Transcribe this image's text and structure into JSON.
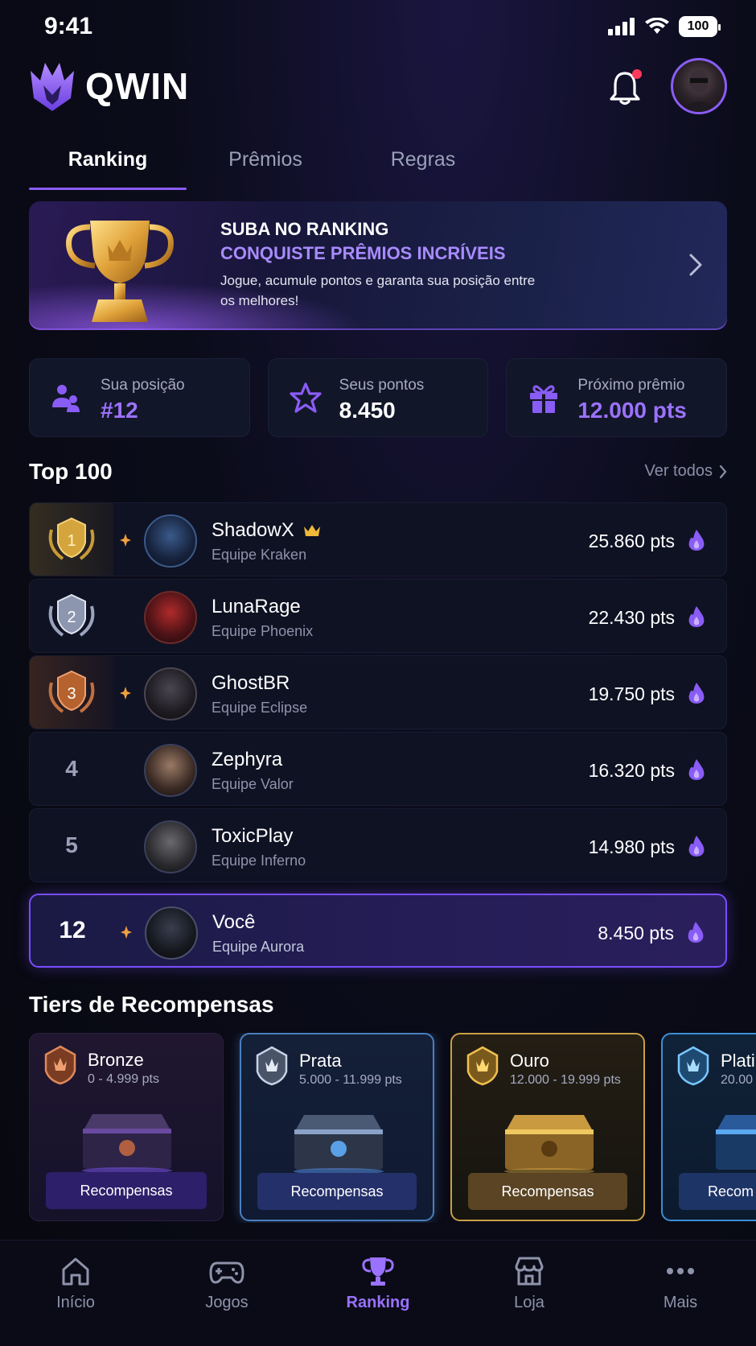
{
  "status_bar": {
    "time": "9:41",
    "battery": "100"
  },
  "header": {
    "brand": "QWIN"
  },
  "tabs": [
    {
      "label": "Ranking",
      "active": true
    },
    {
      "label": "Prêmios",
      "active": false
    },
    {
      "label": "Regras",
      "active": false
    }
  ],
  "banner": {
    "title": "SUBA NO RANKING",
    "subtitle": "CONQUISTE PRÊMIOS INCRÍVEIS",
    "description": "Jogue, acumule pontos e garanta sua posição entre os melhores!"
  },
  "stats": [
    {
      "label": "Sua posição",
      "value": "#12",
      "icon": "user-group-icon"
    },
    {
      "label": "Seus pontos",
      "value": "8.450",
      "icon": "star-icon"
    },
    {
      "label": "Próximo prêmio",
      "value": "12.000 pts",
      "icon": "gift-icon"
    }
  ],
  "top100": {
    "title": "Top 100",
    "see_all": "Ver todos",
    "rows": [
      {
        "rank": "1",
        "name": "ShadowX",
        "team": "Equipe Kraken",
        "points": "25.860 pts"
      },
      {
        "rank": "2",
        "name": "LunaRage",
        "team": "Equipe Phoenix",
        "points": "22.430 pts"
      },
      {
        "rank": "3",
        "name": "GhostBR",
        "team": "Equipe Eclipse",
        "points": "19.750 pts"
      },
      {
        "rank": "4",
        "name": "Zephyra",
        "team": "Equipe Valor",
        "points": "16.320 pts"
      },
      {
        "rank": "5",
        "name": "ToxicPlay",
        "team": "Equipe Inferno",
        "points": "14.980 pts"
      }
    ],
    "you": {
      "rank": "12",
      "name": "Você",
      "team": "Equipe Aurora",
      "points": "8.450 pts"
    }
  },
  "tiers": {
    "title": "Tiers de Recompensas",
    "items": [
      {
        "name": "Bronze",
        "range": "0 - 4.999 pts",
        "button": "Recompensas",
        "color": "#c56a3c"
      },
      {
        "name": "Prata",
        "range": "5.000 - 11.999 pts",
        "button": "Recompensas",
        "color": "#aab4c8"
      },
      {
        "name": "Ouro",
        "range": "12.000 - 19.999 pts",
        "button": "Recompensas",
        "color": "#e0b040"
      },
      {
        "name": "Plati",
        "range": "20.00",
        "button": "Recom",
        "color": "#5ab0ef"
      }
    ]
  },
  "bottom_nav": [
    {
      "label": "Início",
      "icon": "home-icon"
    },
    {
      "label": "Jogos",
      "icon": "gamepad-icon"
    },
    {
      "label": "Ranking",
      "icon": "trophy-icon",
      "active": true
    },
    {
      "label": "Loja",
      "icon": "store-icon"
    },
    {
      "label": "Mais",
      "icon": "more-icon"
    }
  ],
  "colors": {
    "accent": "#8a5cf6",
    "background": "#07080f"
  }
}
